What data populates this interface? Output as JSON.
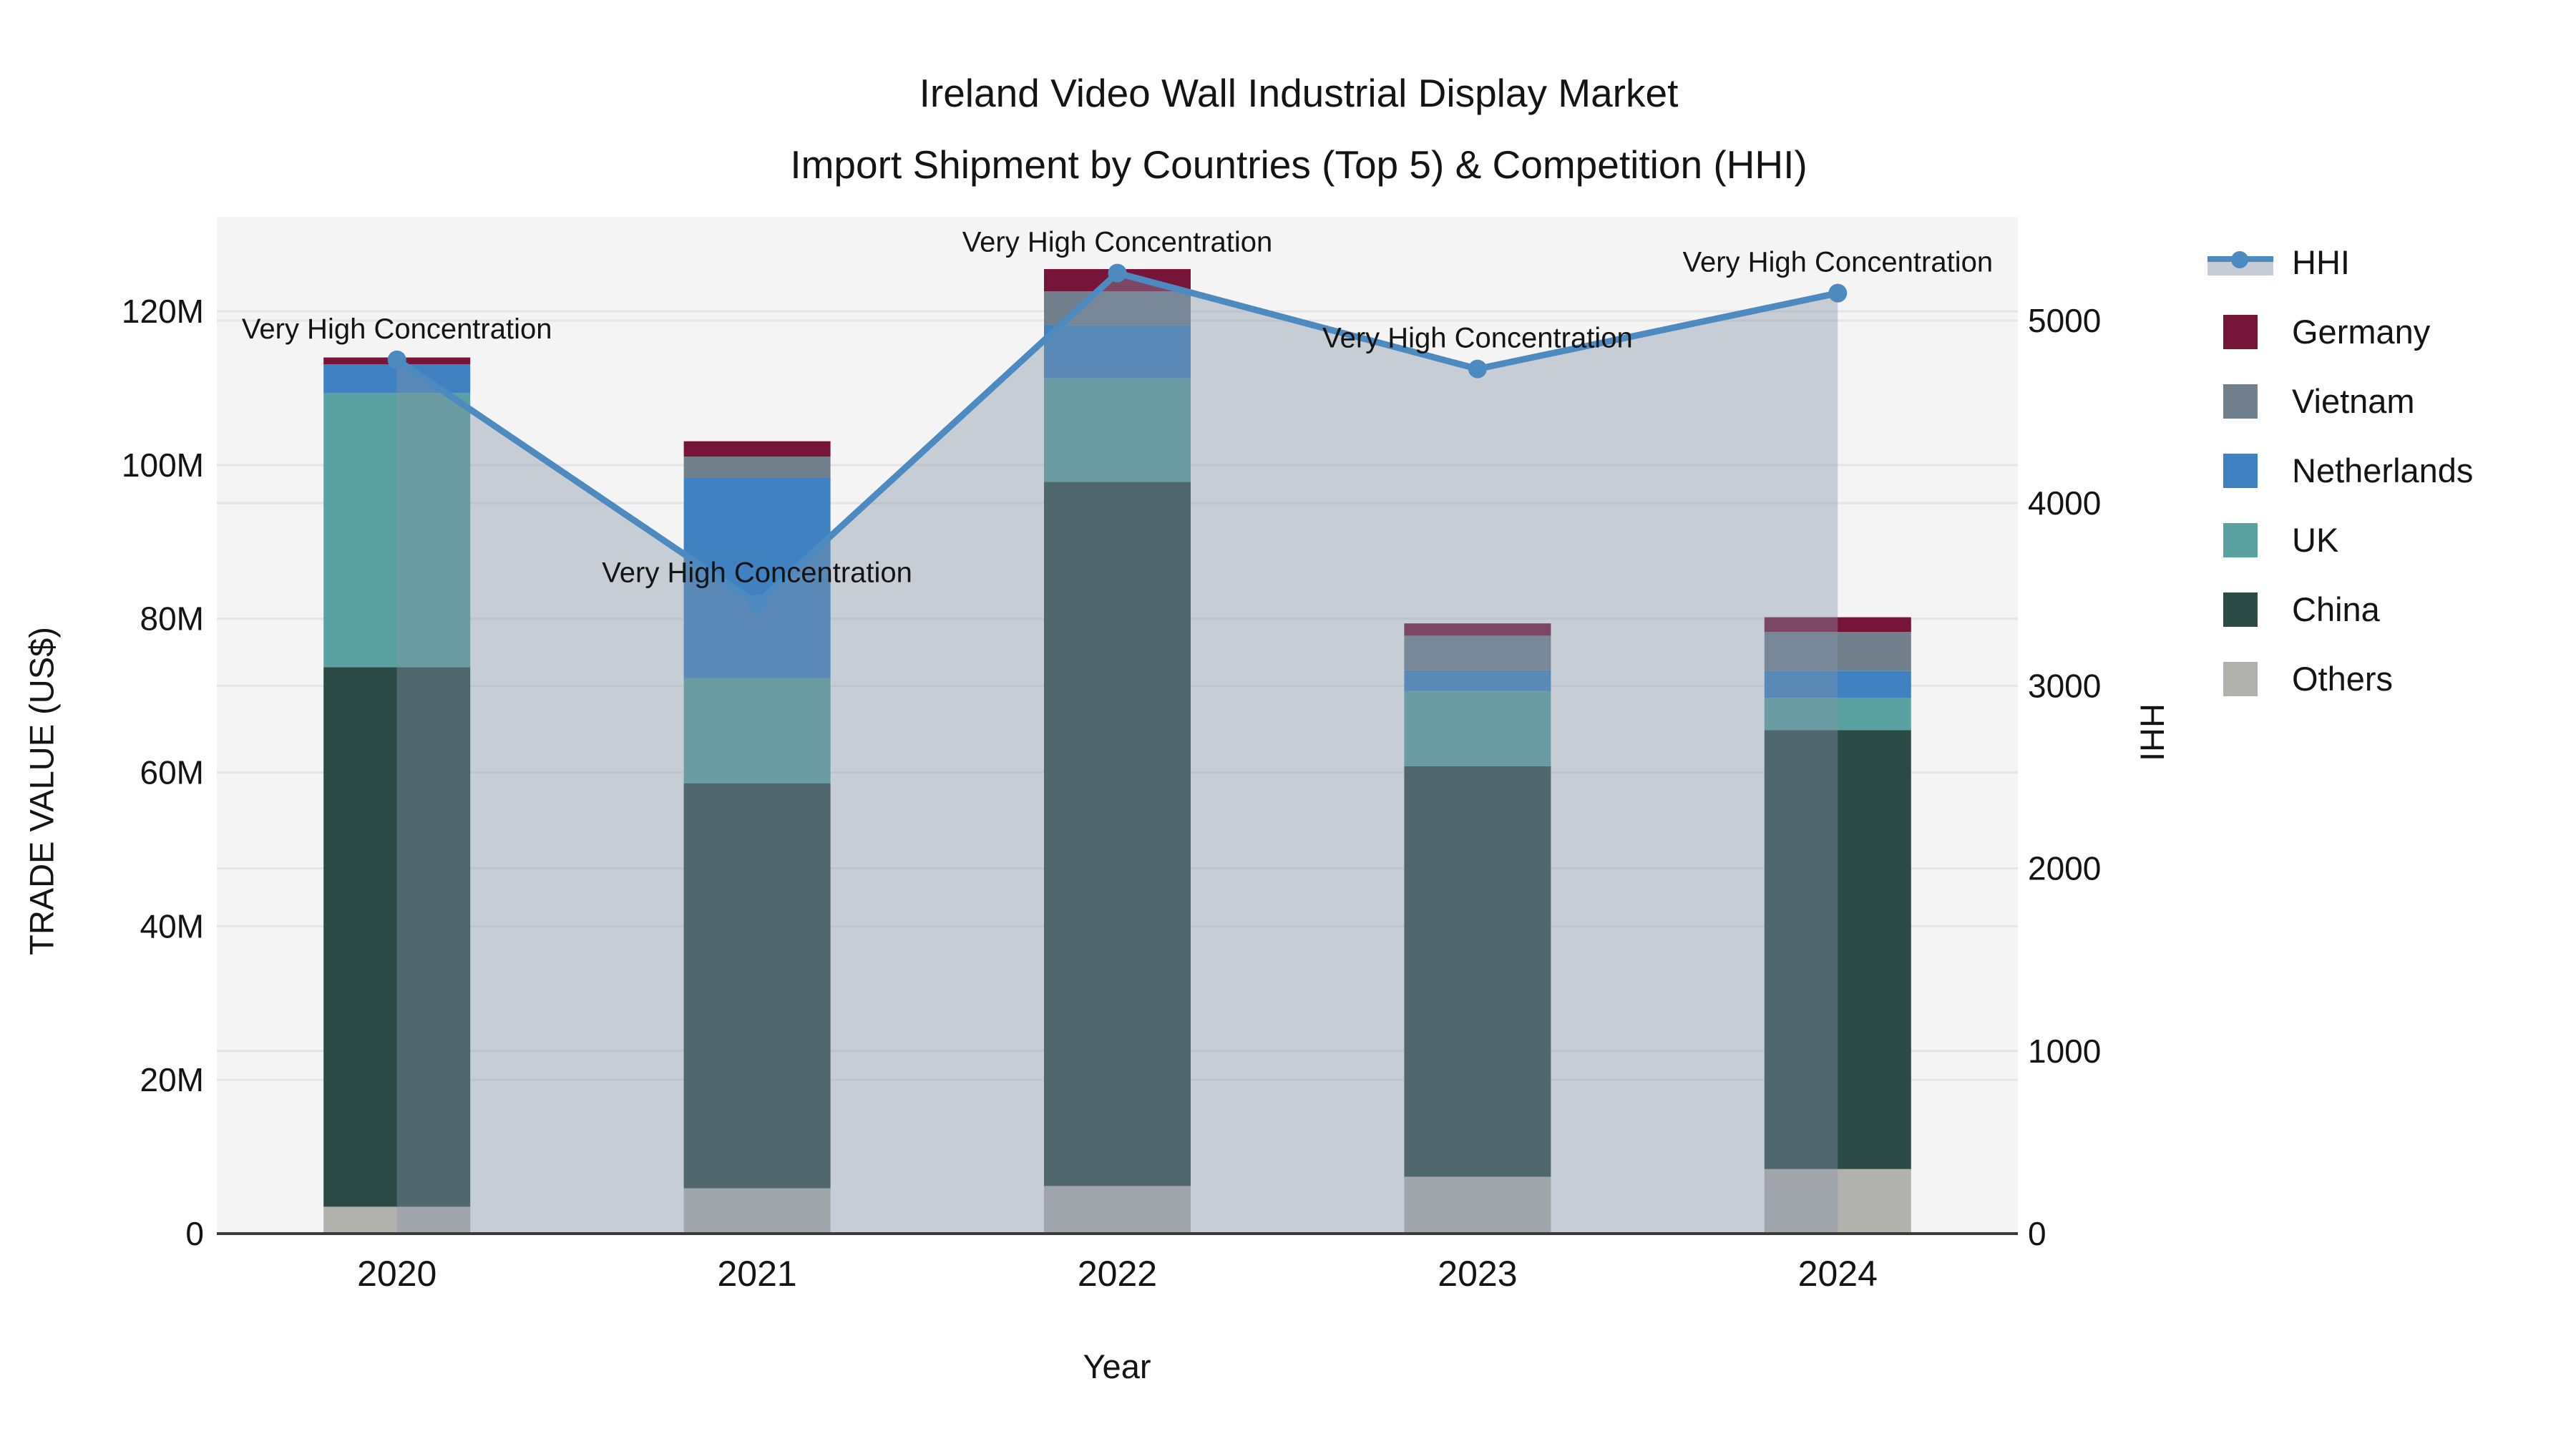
{
  "title": {
    "line1": "Ireland Video Wall Industrial Display Market",
    "line2": "Import Shipment by Countries (Top 5) & Competition (HHI)"
  },
  "axes": {
    "x_label": "Year",
    "y_left_label": "TRADE VALUE (US$)",
    "y_right_label": "HHI",
    "y_left_ticks": [
      {
        "value": 0,
        "label": "0"
      },
      {
        "value": 20,
        "label": "20M"
      },
      {
        "value": 40,
        "label": "40M"
      },
      {
        "value": 60,
        "label": "60M"
      },
      {
        "value": 80,
        "label": "80M"
      },
      {
        "value": 100,
        "label": "100M"
      },
      {
        "value": 120,
        "label": "120M"
      }
    ],
    "y_right_ticks": [
      {
        "value": 0,
        "label": "0"
      },
      {
        "value": 1000,
        "label": "1000"
      },
      {
        "value": 2000,
        "label": "2000"
      },
      {
        "value": 3000,
        "label": "3000"
      },
      {
        "value": 4000,
        "label": "4000"
      },
      {
        "value": 5000,
        "label": "5000"
      }
    ],
    "grid": true,
    "plot_background": "#f4f4f4",
    "gridline_color": "#e4e4e6",
    "spine_color": "#3a3a3a"
  },
  "chart_data": {
    "type": "bar",
    "subtype": "stacked-bars-with-line-on-secondary-axis",
    "categories": [
      "2020",
      "2021",
      "2022",
      "2023",
      "2024"
    ],
    "value_unit": "million US$",
    "ylim_left": [
      0,
      132.3
    ],
    "ylim_right": [
      0,
      5568
    ],
    "legend_position": "right-outside",
    "series": [
      {
        "name": "Others",
        "color": "#b1b1ae",
        "values": [
          3.5,
          5.9,
          6.2,
          7.4,
          8.4
        ]
      },
      {
        "name": "China",
        "color": "#2d4b46",
        "values": [
          70.2,
          52.7,
          91.6,
          53.4,
          57.1
        ]
      },
      {
        "name": "UK",
        "color": "#5ba1a1",
        "values": [
          35.7,
          13.7,
          13.5,
          9.8,
          4.2
        ]
      },
      {
        "name": "Netherlands",
        "color": "#3f81c1",
        "values": [
          3.7,
          26.1,
          6.9,
          2.7,
          3.5
        ]
      },
      {
        "name": "Vietnam",
        "color": "#72808e",
        "values": [
          0.0,
          2.7,
          4.4,
          4.5,
          5.1
        ]
      },
      {
        "name": "Germany",
        "color": "#771539",
        "values": [
          0.9,
          2.0,
          2.9,
          1.6,
          1.9
        ]
      }
    ],
    "bar_totals": [
      114.0,
      103.1,
      125.5,
      79.4,
      80.2
    ],
    "hhi": {
      "name": "HHI",
      "values": [
        4785,
        3450,
        5260,
        4735,
        5150
      ],
      "line_color": "#4d8ac0",
      "area_fill_color": "rgba(132,148,168,0.40)"
    },
    "annotations": [
      {
        "category": "2020",
        "text": "Very High Concentration"
      },
      {
        "category": "2021",
        "text": "Very High Concentration"
      },
      {
        "category": "2022",
        "text": "Very High Concentration"
      },
      {
        "category": "2023",
        "text": "Very High Concentration"
      },
      {
        "category": "2024",
        "text": "Very High Concentration"
      }
    ]
  },
  "legend": {
    "items": [
      {
        "label": "HHI",
        "type": "line",
        "color": "#4d8ac0"
      },
      {
        "label": "Germany",
        "type": "patch",
        "color": "#771539"
      },
      {
        "label": "Vietnam",
        "type": "patch",
        "color": "#72808e"
      },
      {
        "label": "Netherlands",
        "type": "patch",
        "color": "#3f81c1"
      },
      {
        "label": "UK",
        "type": "patch",
        "color": "#5ba1a1"
      },
      {
        "label": "China",
        "type": "patch",
        "color": "#2d4b46"
      },
      {
        "label": "Others",
        "type": "patch",
        "color": "#b1b1ae"
      }
    ]
  }
}
